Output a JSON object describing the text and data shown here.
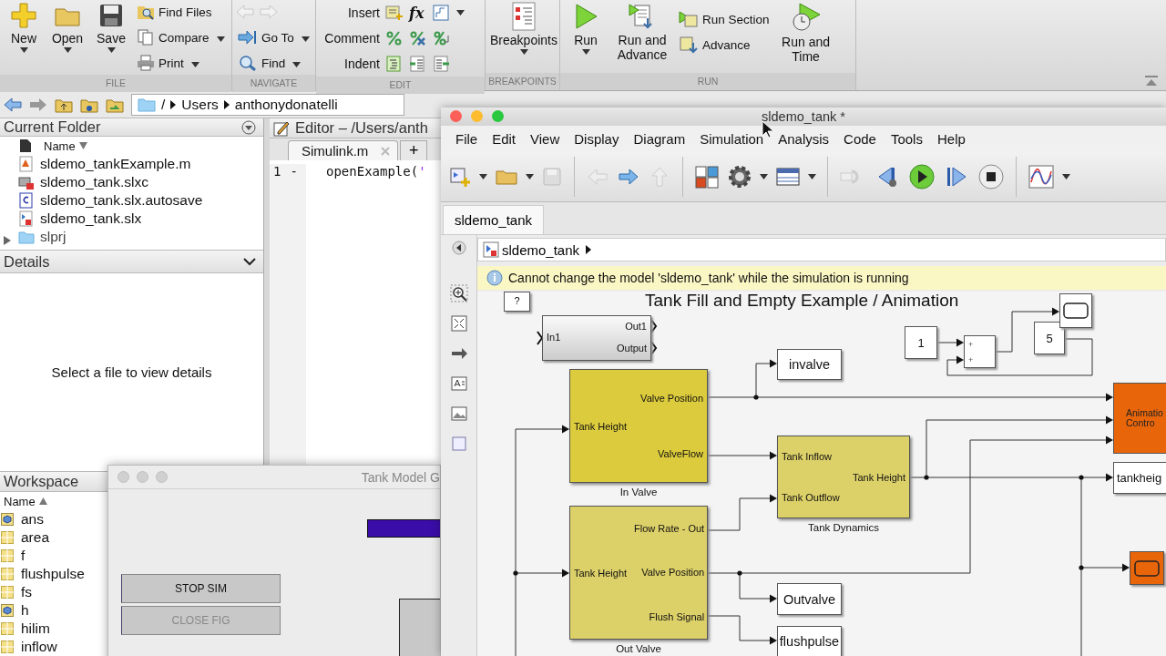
{
  "toolstrip": {
    "file": {
      "title": "FILE",
      "large": [
        {
          "label": "New",
          "menu": true
        },
        {
          "label": "Open",
          "menu": true
        },
        {
          "label": "Save",
          "menu": true
        }
      ],
      "small": [
        {
          "label": "Find Files",
          "menu": false
        },
        {
          "label": "Compare",
          "menu": true
        },
        {
          "label": "Print",
          "menu": true
        }
      ]
    },
    "navigate": {
      "title": "NAVIGATE",
      "small": [
        {
          "label": "Go To",
          "menu": true
        },
        {
          "label": "Find",
          "menu": true
        }
      ]
    },
    "edit": {
      "title": "EDIT",
      "function_icon": "fx",
      "rows": [
        {
          "label": "Insert"
        },
        {
          "label": "Comment"
        },
        {
          "label": "Indent"
        }
      ]
    },
    "breakpoints": {
      "title": "BREAKPOINTS",
      "large": [
        {
          "label": "Breakpoints",
          "menu": true
        }
      ]
    },
    "run": {
      "title": "RUN",
      "large": [
        {
          "label": "Run",
          "menu": true
        },
        {
          "label": "Run and Advance",
          "menu": false
        }
      ],
      "small": [
        {
          "label": "Run Section"
        },
        {
          "label": "Advance"
        }
      ],
      "timed": [
        {
          "label": "Run and Time",
          "menu": false
        }
      ]
    }
  },
  "address": {
    "crumbs": [
      "/",
      "Users",
      "anthonydonatelli"
    ]
  },
  "current_folder": {
    "title": "Current Folder",
    "column": "Name",
    "files": [
      {
        "name": "sldemo_tankExample.m",
        "kind": "mfile"
      },
      {
        "name": "sldemo_tank.slxc",
        "kind": "slxc"
      },
      {
        "name": "sldemo_tank.slx.autosave",
        "kind": "autosave"
      },
      {
        "name": "sldemo_tank.slx",
        "kind": "slx"
      },
      {
        "name": "slprj",
        "kind": "folder"
      }
    ]
  },
  "details": {
    "title": "Details",
    "message": "Select a file to view details"
  },
  "editor": {
    "title": "Editor – /Users/anth",
    "tabs": [
      {
        "label": "Simulink.m",
        "selected": true
      }
    ],
    "new_tab": "+",
    "lines": [
      {
        "number": "1",
        "mark": "-",
        "code": "openExample(",
        "string": "'"
      }
    ]
  },
  "workspace": {
    "title": "Workspace",
    "column": "Name",
    "vars": [
      {
        "name": "ans",
        "kind": "object"
      },
      {
        "name": "area",
        "kind": "array"
      },
      {
        "name": "f",
        "kind": "array"
      },
      {
        "name": "flushpulse",
        "kind": "array"
      },
      {
        "name": "fs",
        "kind": "array"
      },
      {
        "name": "h",
        "kind": "object"
      },
      {
        "name": "hilim",
        "kind": "array"
      },
      {
        "name": "inflow",
        "kind": "array"
      }
    ]
  },
  "gui_window": {
    "title": "Tank Model G",
    "buttons": [
      {
        "label": "STOP SIM",
        "disabled": false
      },
      {
        "label": "CLOSE FIG",
        "disabled": true
      }
    ]
  },
  "simulink": {
    "title": "sldemo_tank *",
    "menus": [
      "File",
      "Edit",
      "View",
      "Display",
      "Diagram",
      "Simulation",
      "Analysis",
      "Code",
      "Tools",
      "Help"
    ],
    "tabs": [
      {
        "label": "sldemo_tank",
        "selected": true
      }
    ],
    "breadcrumb": "sldemo_tank",
    "banner": "Cannot change the model 'sldemo_tank' while the simulation is running",
    "diagram": {
      "title": "Tank Fill and Empty Example / Animation",
      "blocks": [
        {
          "kind": "help",
          "text": "?"
        },
        {
          "kind": "subsystem",
          "inputs": [
            "In1"
          ],
          "outputs": [
            "Out1",
            "Output"
          ]
        },
        {
          "kind": "tag",
          "text": "invalve"
        },
        {
          "kind": "valve",
          "name": "In Valve",
          "color": "#dccb3c",
          "inputs": [
            "Tank Height"
          ],
          "outputs": [
            "Valve Position",
            "ValveFlow"
          ]
        },
        {
          "kind": "valve",
          "name": "Tank Dynamics",
          "color": "#dcd068",
          "inputs": [
            "Tank Inflow",
            "Tank Outflow"
          ],
          "outputs": [
            "Tank Height"
          ]
        },
        {
          "kind": "valve",
          "name": "Out Valve",
          "color": "#dcd068",
          "inputs": [
            "Tank Height"
          ],
          "outputs": [
            "Flow Rate - Out",
            "Valve Position",
            "Flush Signal"
          ]
        },
        {
          "kind": "tag",
          "text": "Outvalve"
        },
        {
          "kind": "tag",
          "text": "flushpulse"
        },
        {
          "kind": "constant",
          "text": "1"
        },
        {
          "kind": "sum",
          "signs": [
            "+",
            "+"
          ]
        },
        {
          "kind": "constant",
          "text": "5"
        },
        {
          "kind": "scope",
          "color": "#ffffff"
        },
        {
          "kind": "control",
          "lines": [
            "Animatio",
            "Contro"
          ],
          "color": "#e8650a"
        },
        {
          "kind": "tag",
          "text": "tankheig"
        },
        {
          "kind": "scope",
          "color": "#e8650a"
        }
      ]
    }
  }
}
